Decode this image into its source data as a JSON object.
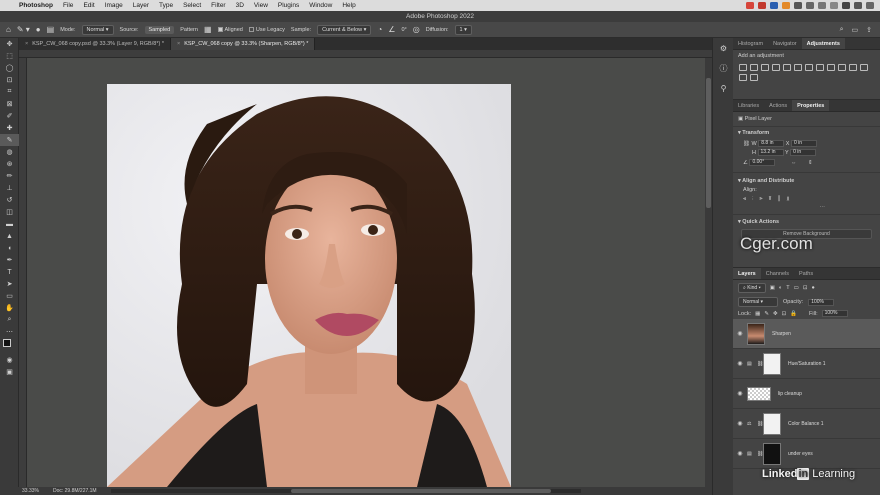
{
  "menubar": {
    "app_name": "Photoshop",
    "items": [
      "File",
      "Edit",
      "Image",
      "Layer",
      "Type",
      "Select",
      "Filter",
      "3D",
      "View",
      "Plugins",
      "Window",
      "Help"
    ]
  },
  "window": {
    "title": "Adobe Photoshop 2022"
  },
  "options_bar": {
    "mode_label": "Mode:",
    "mode_value": "Normal",
    "source_label": "Source:",
    "source_sampled": "Sampled",
    "source_pattern": "Pattern",
    "aligned_label": "Aligned",
    "aligned_checked": true,
    "use_legacy_label": "Use Legacy",
    "use_legacy_checked": false,
    "sample_label": "Sample:",
    "sample_value": "Current & Below",
    "angle_value": "0°",
    "diffusion_label": "Diffusion:",
    "diffusion_value": "1"
  },
  "document_tabs": [
    {
      "label": "KSP_CW_068 copy.psd @ 33.3% (Layer 9, RGB/8*) *",
      "active": false
    },
    {
      "label": "KSP_CW_068 copy @ 33.3% (Sharpen, RGB/8*) *",
      "active": true
    }
  ],
  "status_bar": {
    "zoom": "33.33%",
    "doc": "Doc: 29.8M/227.1M"
  },
  "panels": {
    "top_tabs": [
      "Histogram",
      "Navigator",
      "Adjustments"
    ],
    "top_active": "Adjustments",
    "adjustments_hint": "Add an adjustment",
    "mid_tabs": [
      "Libraries",
      "Actions",
      "Properties"
    ],
    "mid_active": "Properties",
    "properties": {
      "layer_type": "Pixel Layer",
      "transform_title": "Transform",
      "w_label": "W",
      "w_value": "8.8 in",
      "h_label": "H",
      "h_value": "13.2 in",
      "x_label": "X",
      "x_value": "0 in",
      "y_label": "Y",
      "y_value": "0 in",
      "angle_value": "0.00°",
      "align_title": "Align and Distribute",
      "align_label": "Align:",
      "quick_actions_title": "Quick Actions",
      "remove_bg_label": "Remove Background"
    },
    "layers_tabs": [
      "Layers",
      "Channels",
      "Paths"
    ],
    "layers_active": "Layers",
    "layers_kind_label": "Kind",
    "blend_mode": "Normal",
    "opacity_label": "Opacity:",
    "opacity_value": "100%",
    "lock_label": "Lock:",
    "fill_label": "Fill:",
    "fill_value": "100%",
    "layers": [
      {
        "name": "Sharpen",
        "selected": true,
        "kind": "photo"
      },
      {
        "name": "Hue/Saturation 1",
        "selected": false,
        "kind": "adjustment"
      },
      {
        "name": "lip cleanup",
        "selected": false,
        "kind": "transparent"
      },
      {
        "name": "Color Balance 1",
        "selected": false,
        "kind": "adjustment"
      },
      {
        "name": "under eyes",
        "selected": false,
        "kind": "dark"
      }
    ]
  },
  "watermark": "Cger.com",
  "brand": {
    "linked": "Linked",
    "in": "in",
    "learning": "Learning"
  },
  "colors": {
    "accent": "#2d8ceb",
    "panel_bg": "#444444",
    "canvas_bg": "#4a4b49"
  }
}
